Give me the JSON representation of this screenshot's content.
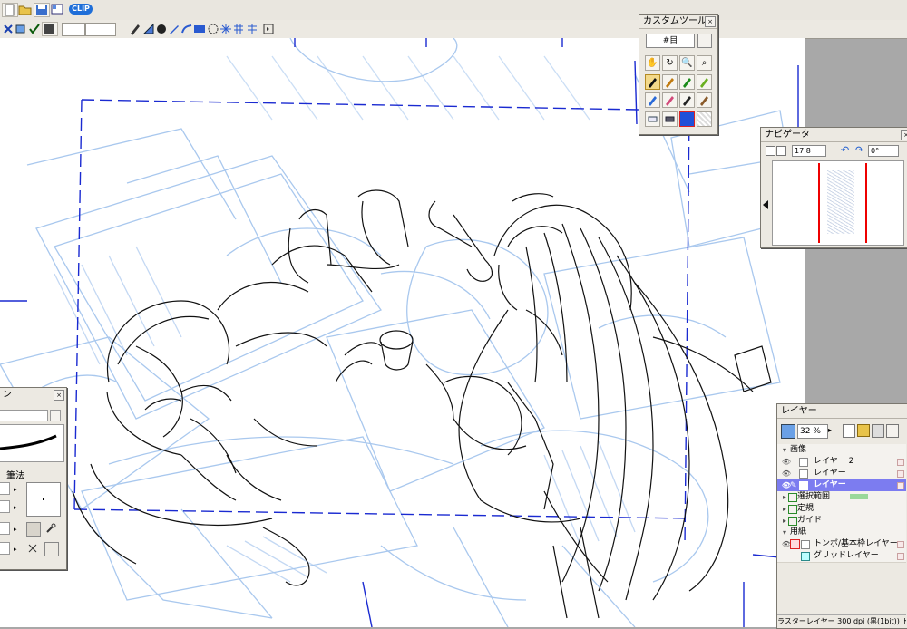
{
  "toolbar": {
    "pill_label": "CLIP",
    "size_field": ""
  },
  "custom_tools": {
    "title": "カスタムツール",
    "preset_value": "#目",
    "tools": [
      "hand-icon",
      "rotate-icon",
      "zoom-icon",
      "loupe-icon",
      "pen-icon",
      "pen-icon",
      "pen-icon",
      "pen-icon",
      "brush-icon",
      "pencil-icon",
      "pen-icon",
      "pen-icon",
      "eraser-icon",
      "eraser-icon",
      "color-icon",
      "pattern-icon"
    ]
  },
  "navigator": {
    "title": "ナビゲータ",
    "zoom": "17.8",
    "angle": "0°"
  },
  "pen_panel": {
    "title": "ン",
    "tab_label": "筆法"
  },
  "layers": {
    "title": "レイヤー",
    "opacity": "32 %",
    "rows": [
      {
        "label": "画像",
        "type": "folder"
      },
      {
        "label": "レイヤー 2",
        "type": "layer"
      },
      {
        "label": "レイヤー",
        "type": "layer"
      },
      {
        "label": "レイヤー",
        "type": "layer",
        "selected": true
      },
      {
        "label": "選択範囲",
        "type": "group"
      },
      {
        "label": "定規",
        "type": "group"
      },
      {
        "label": "ガイド",
        "type": "group"
      },
      {
        "label": "用紙",
        "type": "folder"
      },
      {
        "label": "トンボ/基本枠レイヤー",
        "type": "layer"
      },
      {
        "label": "グリッドレイヤー",
        "type": "layer"
      }
    ],
    "status": "ラスターレイヤー 300 dpi (黒(1bit)) ト位"
  },
  "colors": {
    "sketch_blue": "#a9c8ee",
    "frame_blue": "#1a2ad1",
    "selected_layer": "#7c7cf0",
    "pill": "#1e6ed8"
  }
}
